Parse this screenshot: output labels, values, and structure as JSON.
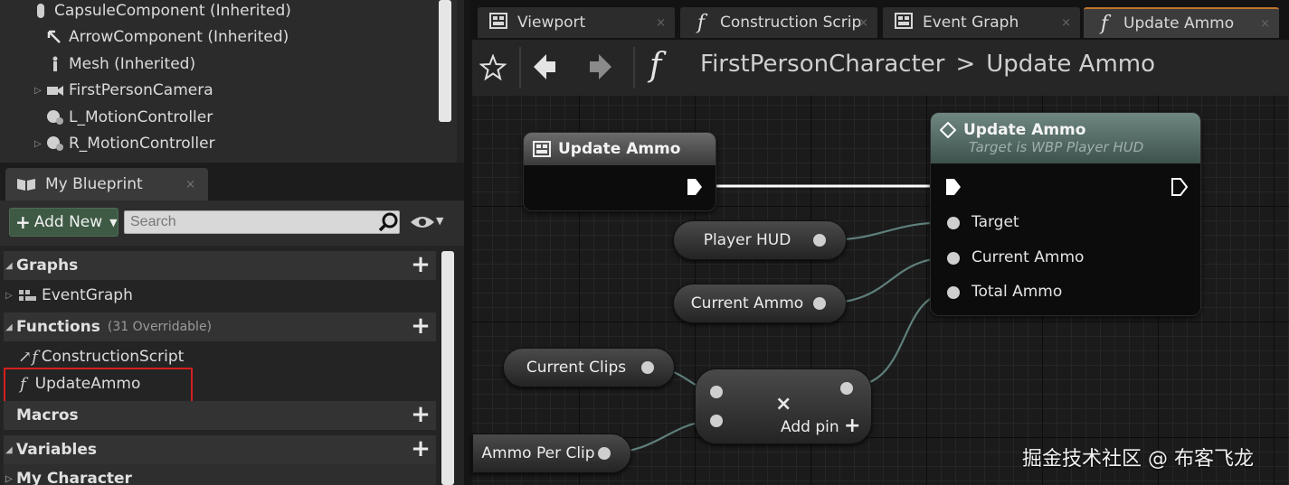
{
  "components": {
    "items": [
      {
        "label": "CapsuleComponent (Inherited)",
        "icon": "capsule-icon",
        "expandable": false
      },
      {
        "label": "ArrowComponent (Inherited)",
        "icon": "arrow-icon",
        "expandable": false
      },
      {
        "label": "Mesh (Inherited)",
        "icon": "mesh-icon",
        "expandable": false
      },
      {
        "label": "FirstPersonCamera",
        "icon": "camera-icon",
        "expandable": true
      },
      {
        "label": "L_MotionController",
        "icon": "motion-controller-icon",
        "expandable": false
      },
      {
        "label": "R_MotionController",
        "icon": "motion-controller-icon",
        "expandable": true
      }
    ]
  },
  "my_blueprint": {
    "tab_label": "My Blueprint",
    "close": "×",
    "add_new_label": "Add New",
    "search_placeholder": "Search",
    "sections": {
      "graphs": {
        "label": "Graphs",
        "add": "+"
      },
      "functions": {
        "label": "Functions",
        "sub": "(31 Overridable)",
        "add": "+"
      },
      "macros": {
        "label": "Macros",
        "add": "+"
      },
      "variables": {
        "label": "Variables",
        "add": "+"
      },
      "my_character": {
        "label": "My Character"
      }
    },
    "graph_items": [
      {
        "label": "EventGraph"
      }
    ],
    "function_items": [
      {
        "label": "ConstructionScript"
      },
      {
        "label": "UpdateAmmo",
        "selected": true
      }
    ]
  },
  "editor": {
    "tabs": [
      {
        "label": "Viewport",
        "icon": "viewport-icon",
        "active": false
      },
      {
        "label": "Construction Scrip",
        "icon": "function-icon",
        "active": false
      },
      {
        "label": "Event Graph",
        "icon": "event-graph-icon",
        "active": false
      },
      {
        "label": "Update Ammo",
        "icon": "function-icon",
        "active": true
      }
    ],
    "tab_close": "×",
    "breadcrumb": {
      "root": "FirstPersonCharacter",
      "separator": ">",
      "current": "Update Ammo"
    }
  },
  "graph": {
    "entry_node": {
      "title": "Update Ammo"
    },
    "call_node": {
      "title": "Update Ammo",
      "subtitle": "Target is WBP Player HUD",
      "pins": [
        "Target",
        "Current Ammo",
        "Total Ammo"
      ]
    },
    "vars": {
      "player_hud": "Player HUD",
      "current_ammo": "Current Ammo",
      "current_clips": "Current Clips",
      "ammo_per_clip": "Ammo Per Clip"
    },
    "multiply_node": {
      "symbol": "×",
      "add_pin_label": "Add pin",
      "add_pin_plus": "+"
    }
  },
  "watermark": "掘金技术社区 @ 布客飞龙",
  "colors": {
    "accent_tab": "#c0752a",
    "selection_box": "#d42020",
    "add_new_bg": "#3e5a45"
  }
}
